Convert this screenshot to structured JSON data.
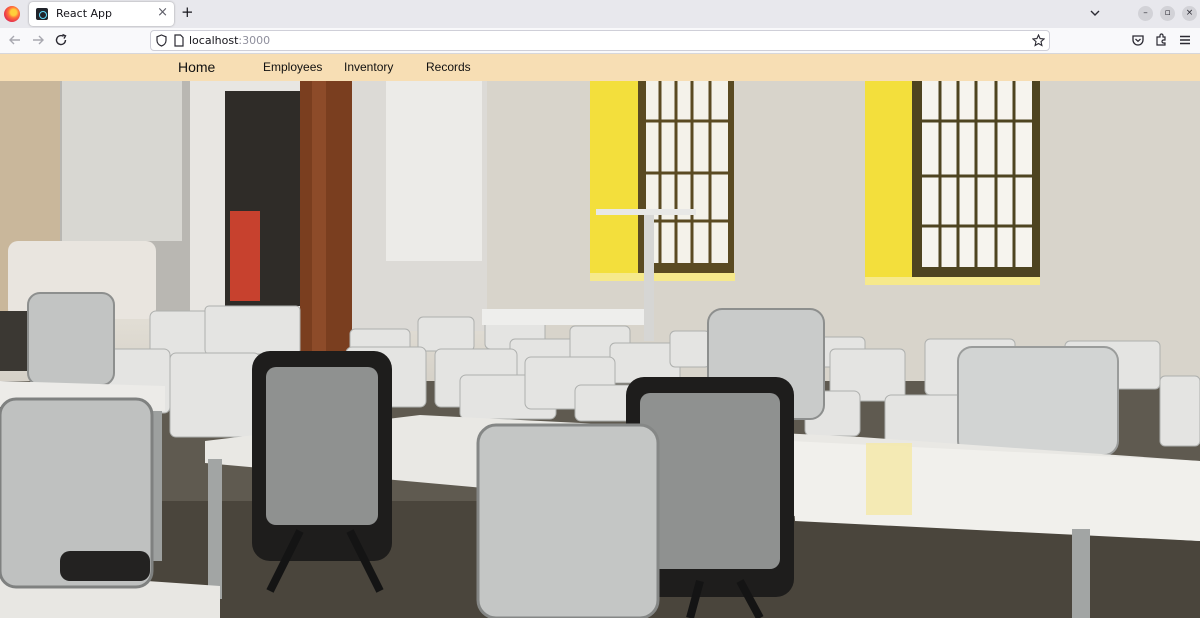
{
  "browser": {
    "tab": {
      "title": "React App",
      "close_glyph": "×"
    },
    "new_tab_glyph": "+",
    "url": {
      "host": "localhost",
      "port": ":3000"
    },
    "icons": [
      "firefox-logo",
      "back-arrow-icon",
      "forward-arrow-icon",
      "reload-icon",
      "shield-icon",
      "page-icon",
      "bookmark-star-icon",
      "pocket-icon",
      "extensions-icon",
      "menu-icon",
      "tab-list-chevron-icon"
    ],
    "window_controls": {
      "minimize": "–",
      "restore": "▫",
      "close": "×"
    }
  },
  "app": {
    "header_color": "#f7deb4",
    "nav": {
      "home": "Home",
      "items": [
        "Employees",
        "Inventory",
        "Records"
      ]
    }
  },
  "hero": {
    "image": "office-room-photo"
  }
}
